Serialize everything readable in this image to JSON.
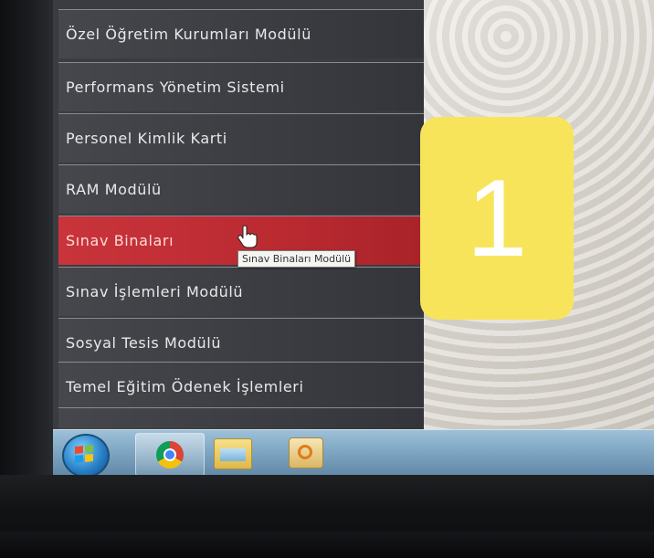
{
  "menu": {
    "items": [
      {
        "label": "Özel Öğretim Kurumları Modülü",
        "active": false
      },
      {
        "label": "Performans Yönetim Sistemi",
        "active": false
      },
      {
        "label": "Personel Kimlik Karti",
        "active": false
      },
      {
        "label": "RAM Modülü",
        "active": false
      },
      {
        "label": "Sınav Binaları",
        "active": true
      },
      {
        "label": "Sınav İşlemleri Modülü",
        "active": false
      },
      {
        "label": "Sosyal Tesis Modülü",
        "active": false
      },
      {
        "label": "Temel Eğitim Ödenek İşlemleri",
        "active": false
      }
    ]
  },
  "tooltip": {
    "text": "Sınav Binaları Modülü"
  },
  "badge": {
    "text": "1",
    "color": "#f8e45b"
  },
  "colors": {
    "active_item": "#c9343b",
    "menu_bg": "#3b3c41",
    "taskbar": "#7ea6c2"
  },
  "taskbar": {
    "items": [
      {
        "icon": "windows-start-icon"
      },
      {
        "icon": "chrome-icon"
      },
      {
        "icon": "folder-icon"
      },
      {
        "icon": "outlook-icon"
      }
    ]
  }
}
